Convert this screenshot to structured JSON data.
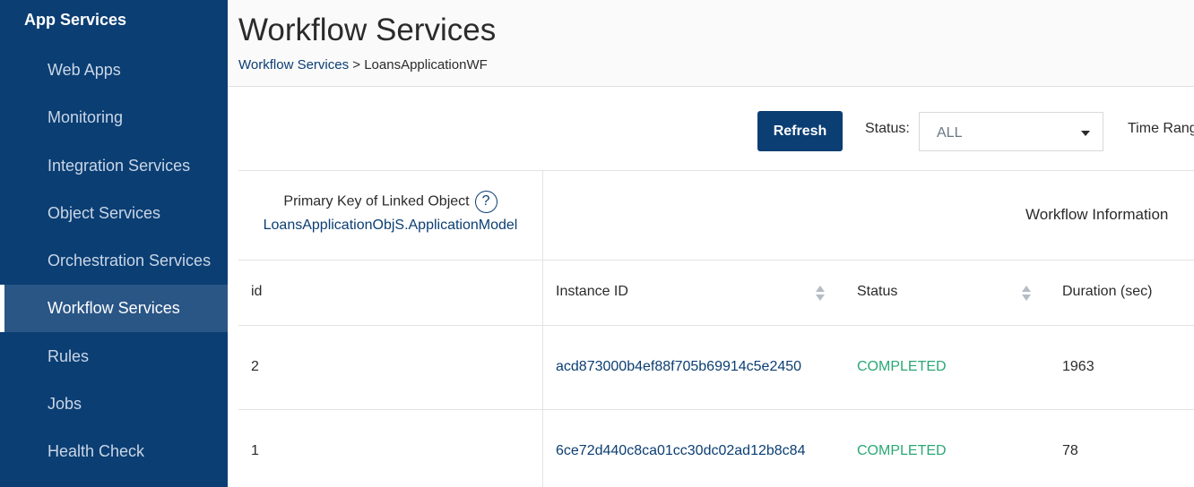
{
  "sidebar": {
    "section_title": "App Services",
    "items": [
      {
        "label": "Web Apps"
      },
      {
        "label": "Monitoring"
      },
      {
        "label": "Integration Services"
      },
      {
        "label": "Object Services"
      },
      {
        "label": "Orchestration Services"
      },
      {
        "label": "Workflow Services",
        "active": true
      },
      {
        "label": "Rules"
      },
      {
        "label": "Jobs"
      },
      {
        "label": "Health Check"
      }
    ]
  },
  "header": {
    "title": "Workflow Services",
    "breadcrumb": {
      "link": "Workflow Services",
      "separator": " > ",
      "current": "LoansApplicationWF"
    }
  },
  "toolbar": {
    "refresh_label": "Refresh",
    "status_label": "Status:",
    "status_value": "ALL",
    "time_range_label": "Time Range"
  },
  "table": {
    "group_primary_key_label": "Primary Key of Linked Object",
    "group_primary_key_object": "LoansApplicationObjS.ApplicationModel",
    "group_workflow_info": "Workflow Information",
    "columns": [
      "id",
      "Instance ID",
      "Status",
      "Duration (sec)"
    ],
    "rows": [
      {
        "id": "2",
        "instance_id": "acd873000b4ef88f705b69914c5e2450",
        "status": "COMPLETED",
        "duration": "1963"
      },
      {
        "id": "1",
        "instance_id": "6ce72d440c8ca01cc30dc02ad12b8c84",
        "status": "COMPLETED",
        "duration": "78"
      }
    ]
  },
  "colors": {
    "sidebar_bg": "#0b3e73",
    "accent": "#0b3e73",
    "status_completed": "#2aa876"
  }
}
